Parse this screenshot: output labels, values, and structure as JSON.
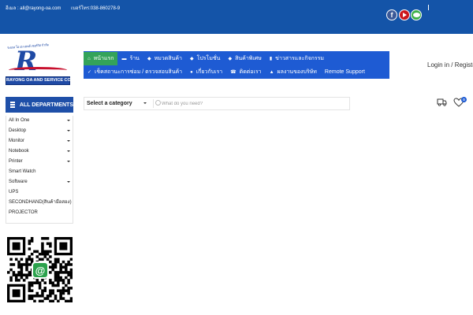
{
  "topbar": {
    "email": "อีเมล : all@rayong-oa.com",
    "phone": "เบอร์โทร:038-860278-9",
    "social": {
      "facebook_icon": "facebook-icon",
      "youtube_icon": "youtube-icon",
      "line_icon": "line-icon",
      "facebook_glyph": "f"
    }
  },
  "logo": {
    "arc_text": "ระยอง โอ เอ แอนด์ เซอร์วิส จำกัด",
    "letter": "R",
    "company": "RAYONG OA AND SERVICE CO.,LTD."
  },
  "nav": {
    "row1": [
      {
        "label": "หน้าแรก",
        "icon": "home-icon",
        "glyph": "⌂"
      },
      {
        "label": "ร้าน",
        "icon": "cart-icon",
        "glyph": "▬"
      },
      {
        "label": "หมวดสินค้า",
        "icon": "tag-icon",
        "glyph": "◆"
      },
      {
        "label": "โปรโมชั่น",
        "icon": "tag-icon",
        "glyph": "◆"
      },
      {
        "label": "สินค้าพิเศษ",
        "icon": "star-tag-icon",
        "glyph": "◆"
      },
      {
        "label": "ข่าวสารและกิจกรรม",
        "icon": "document-icon",
        "glyph": "▮"
      }
    ],
    "row2": [
      {
        "label": "เช็คสถานะการซ่อม / ตรวจสอบสินค้า",
        "icon": "check-icon",
        "glyph": "✓"
      },
      {
        "label": "เกี่ยวกับเรา",
        "icon": "user-icon",
        "glyph": "●"
      },
      {
        "label": "ติดต่อเรา",
        "icon": "phone-icon",
        "glyph": "☎"
      },
      {
        "label": "ผลงานของบริษัท",
        "icon": "network-icon",
        "glyph": "▲"
      },
      {
        "label": "Remote Support",
        "icon": "",
        "glyph": ""
      }
    ]
  },
  "header": {
    "login_register": "Login in / Register"
  },
  "departments": {
    "title": "ALL DEPARTMENTS",
    "items": [
      {
        "label": "All In One",
        "has_submenu": true
      },
      {
        "label": "Desktop",
        "has_submenu": true
      },
      {
        "label": "Monitor",
        "has_submenu": true
      },
      {
        "label": "Notebook",
        "has_submenu": true
      },
      {
        "label": "Printer",
        "has_submenu": true
      },
      {
        "label": "Smart Watch",
        "has_submenu": false
      },
      {
        "label": "Software",
        "has_submenu": true
      },
      {
        "label": "UPS",
        "has_submenu": false
      },
      {
        "label": "SECONDHAND(สินค้ามือสอง)",
        "has_submenu": false
      },
      {
        "label": "PROJECTOR",
        "has_submenu": false
      }
    ]
  },
  "search": {
    "category_label": "Select a category",
    "placeholder": "What do you need?"
  },
  "header_icons": {
    "compare_icon": "truck-icon",
    "wishlist_icon": "heart-icon",
    "wishlist_count": "0"
  },
  "qr": {
    "line_symbol": "@"
  },
  "colors": {
    "topbar": "#1454a8",
    "nav": "#1e5bd3",
    "nav_active": "#33a35a",
    "departments": "#1e4fa8",
    "line_green": "#2ba24c"
  }
}
